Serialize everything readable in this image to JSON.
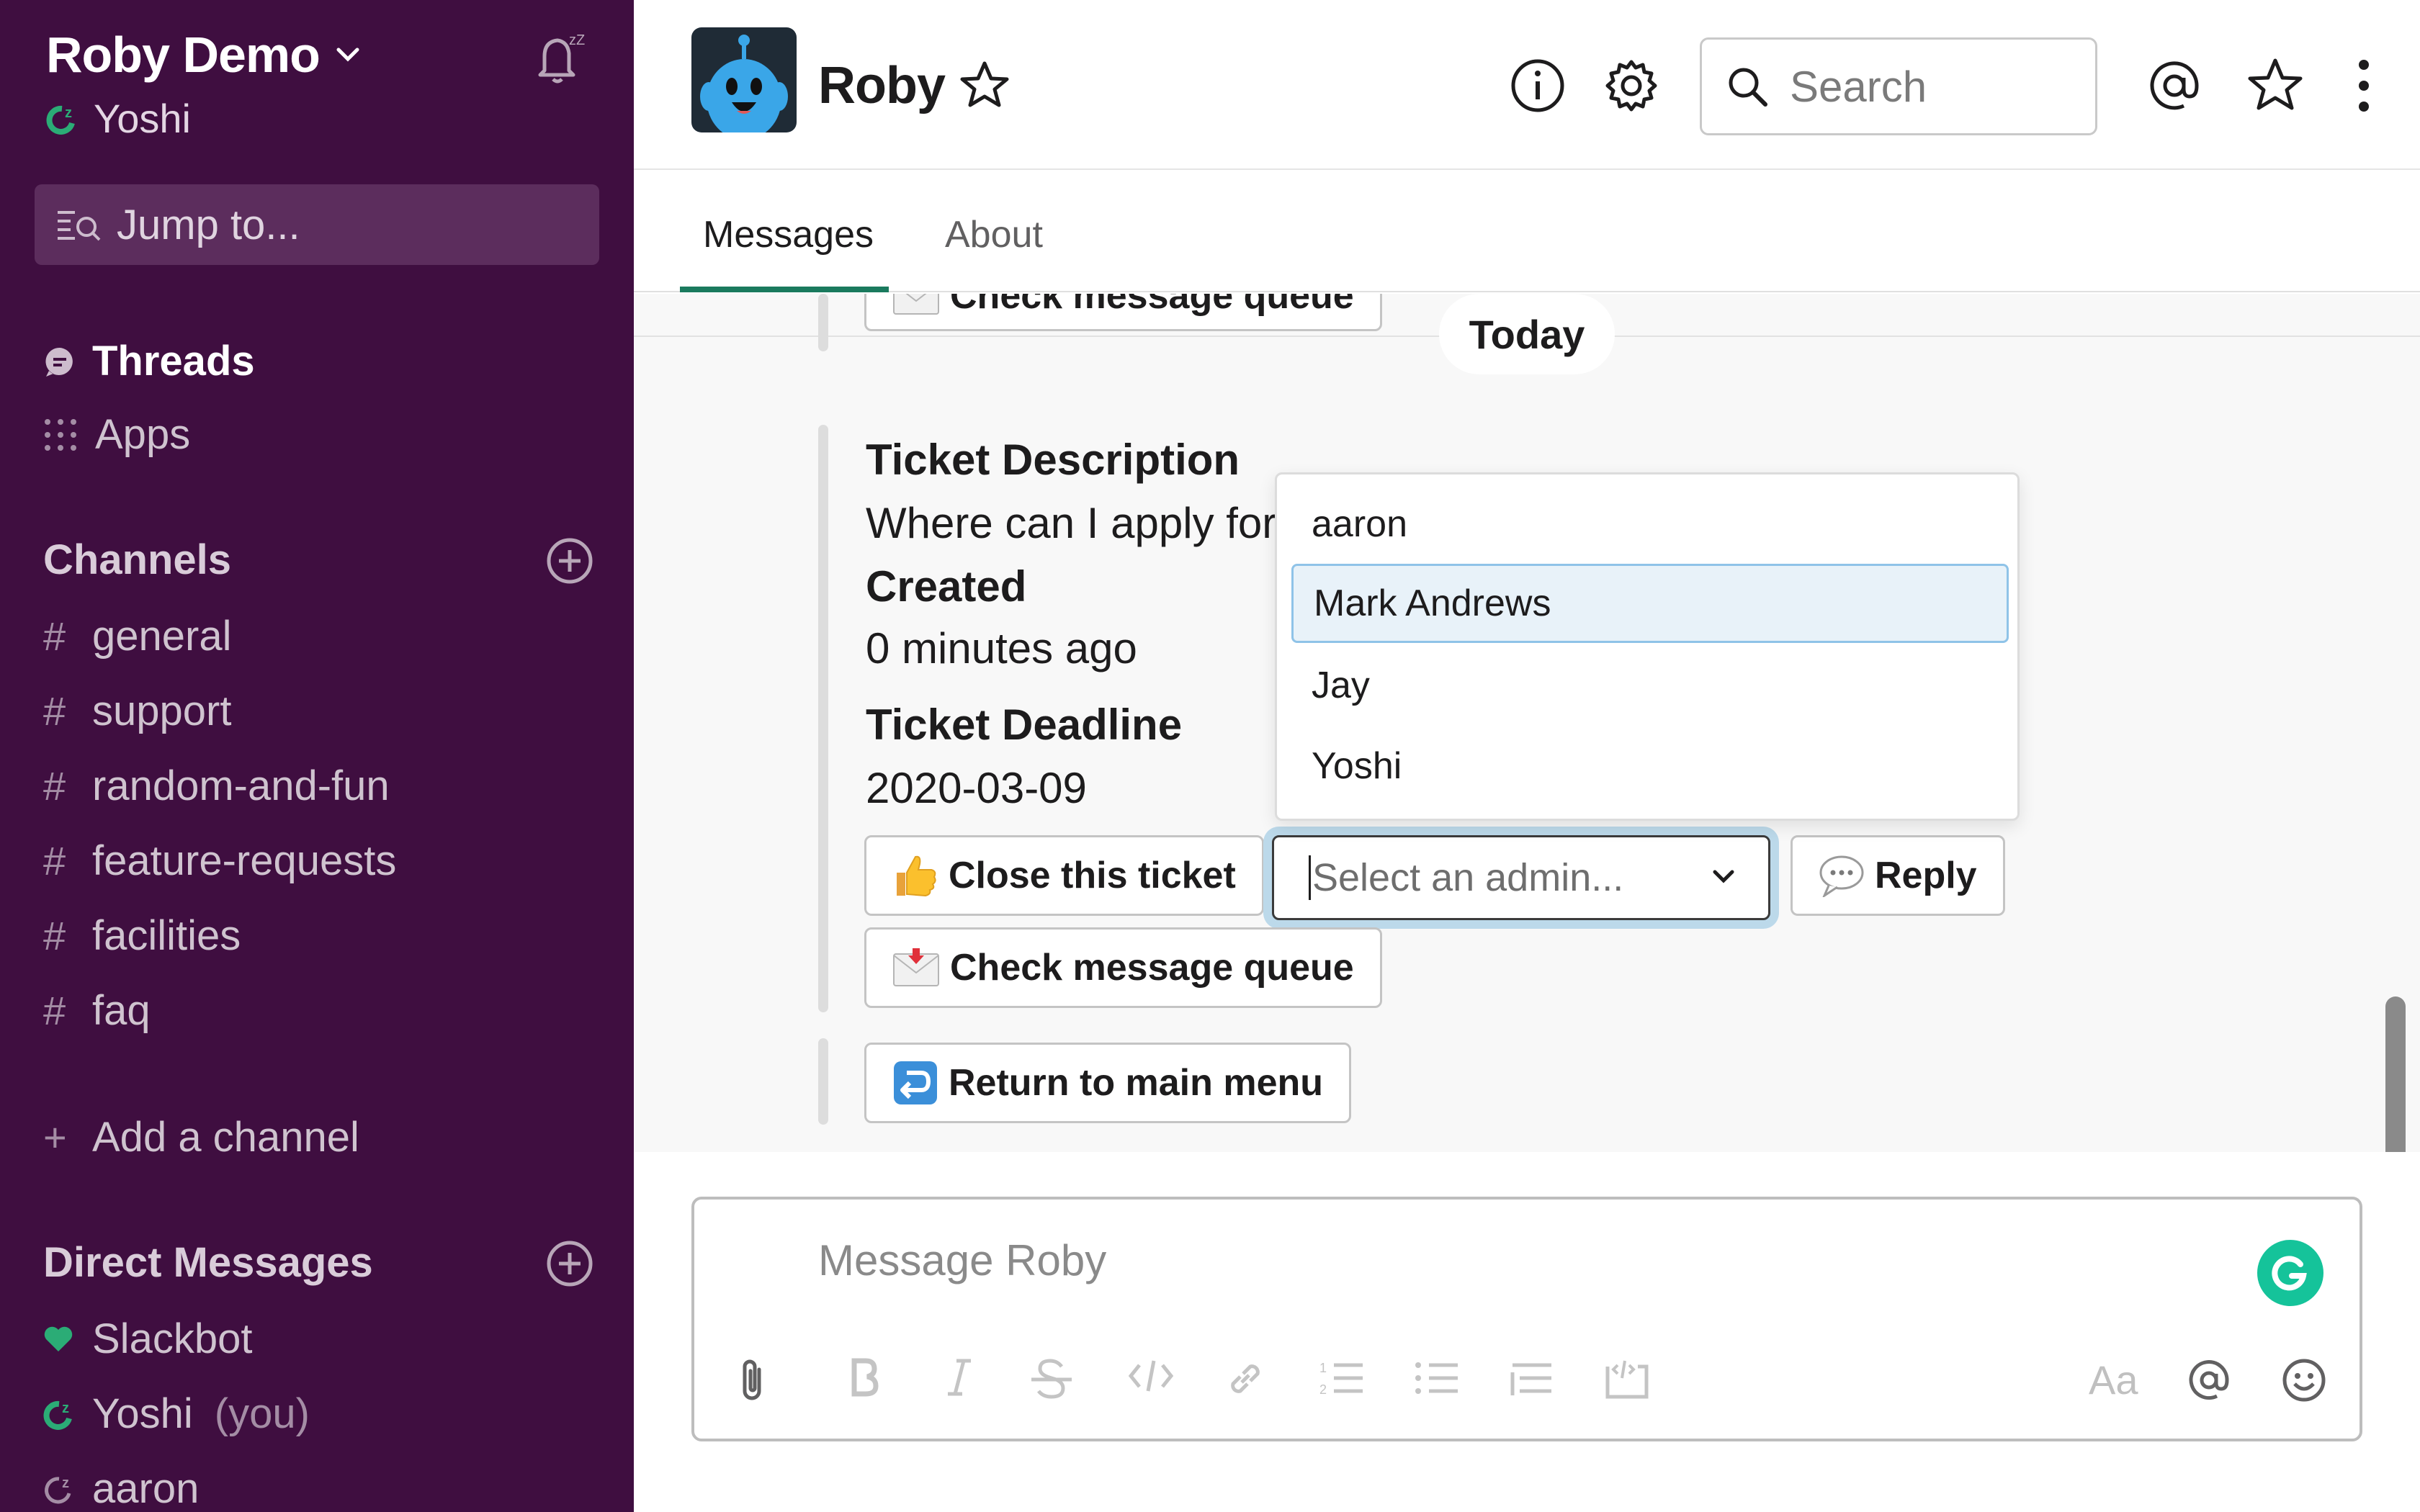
{
  "sidebar": {
    "workspace_name": "Roby Demo",
    "user_name": "Yoshi",
    "jump_placeholder": "Jump to...",
    "threads_label": "Threads",
    "apps_label": "Apps",
    "channels_header": "Channels",
    "channels": [
      "general",
      "support",
      "random-and-fun",
      "feature-requests",
      "facilities",
      "faq"
    ],
    "add_channel_label": "Add a channel",
    "dm_header": "Direct Messages",
    "dms": [
      {
        "name": "Slackbot",
        "suffix": ""
      },
      {
        "name": "Yoshi",
        "suffix": "(you)"
      },
      {
        "name": "aaron",
        "suffix": ""
      }
    ]
  },
  "header": {
    "title": "Roby",
    "search_placeholder": "Search",
    "tabs": [
      "Messages",
      "About"
    ]
  },
  "messages": {
    "date_divider": "Today",
    "top_button": "Check message queue",
    "fields": {
      "desc_label": "Ticket Description",
      "desc_value": "Where can I apply for",
      "created_label": "Created",
      "created_value": "0 minutes ago",
      "deadline_label": "Ticket Deadline",
      "deadline_value": "2020-03-09"
    },
    "close_button": "Close this ticket",
    "select_placeholder": "Select an admin...",
    "reply_button": "Reply",
    "queue_button": "Check message queue",
    "return_button": "Return to main menu",
    "dropdown_options": [
      "aaron",
      "Mark Andrews",
      "Jay",
      "Yoshi"
    ],
    "dropdown_highlighted": "Mark Andrews"
  },
  "composer": {
    "placeholder": "Message Roby",
    "format_label": "Aa"
  },
  "colors": {
    "sidebar_bg": "#3f0e40",
    "accent_green": "#1a7a5e",
    "presence_green": "#2bac76",
    "select_focus": "#bcd9ea",
    "grammarly": "#15c39a"
  },
  "icons": [
    "chevron-down-icon",
    "bell-snooze-icon",
    "jump-search-icon",
    "threads-icon",
    "apps-grid-icon",
    "plus-circle-icon",
    "heart-icon",
    "info-icon",
    "gear-icon",
    "search-icon",
    "at-icon",
    "star-icon",
    "kebab-icon",
    "paperclip-icon",
    "bold-icon",
    "italic-icon",
    "strike-icon",
    "code-icon",
    "link-icon",
    "ordered-list-icon",
    "bullet-list-icon",
    "quote-icon",
    "code-block-icon",
    "emoji-icon",
    "grammarly-icon"
  ]
}
